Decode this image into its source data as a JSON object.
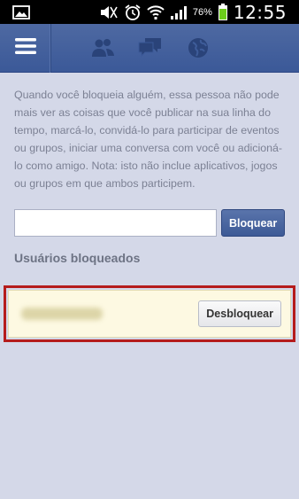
{
  "status_bar": {
    "battery_percent": "76%",
    "time": "12:55",
    "icons": [
      "image-icon",
      "mute-icon",
      "alarm-icon",
      "wifi-icon",
      "signal-icon",
      "battery-icon"
    ]
  },
  "fb_bar": {
    "menu_icon": "hamburger-menu-icon",
    "nav_icons": [
      "friend-requests-icon",
      "messages-icon",
      "notifications-globe-icon"
    ],
    "colors": {
      "bar": "#3b5998"
    }
  },
  "page": {
    "description": "Quando você bloqueia alguém, essa pessoa não pode mais ver as coisas que você publicar na sua linha do tempo, marcá-lo, convidá-lo para participar de eventos ou grupos, iniciar uma conversa com você ou adicioná-lo como amigo. Nota: isto não inclue aplicativos, jogos ou grupos em que ambos participem.",
    "block_input_value": "",
    "block_button": "Bloquear",
    "section_title": "Usuários bloqueados",
    "unblock_button": "Desbloquear"
  }
}
